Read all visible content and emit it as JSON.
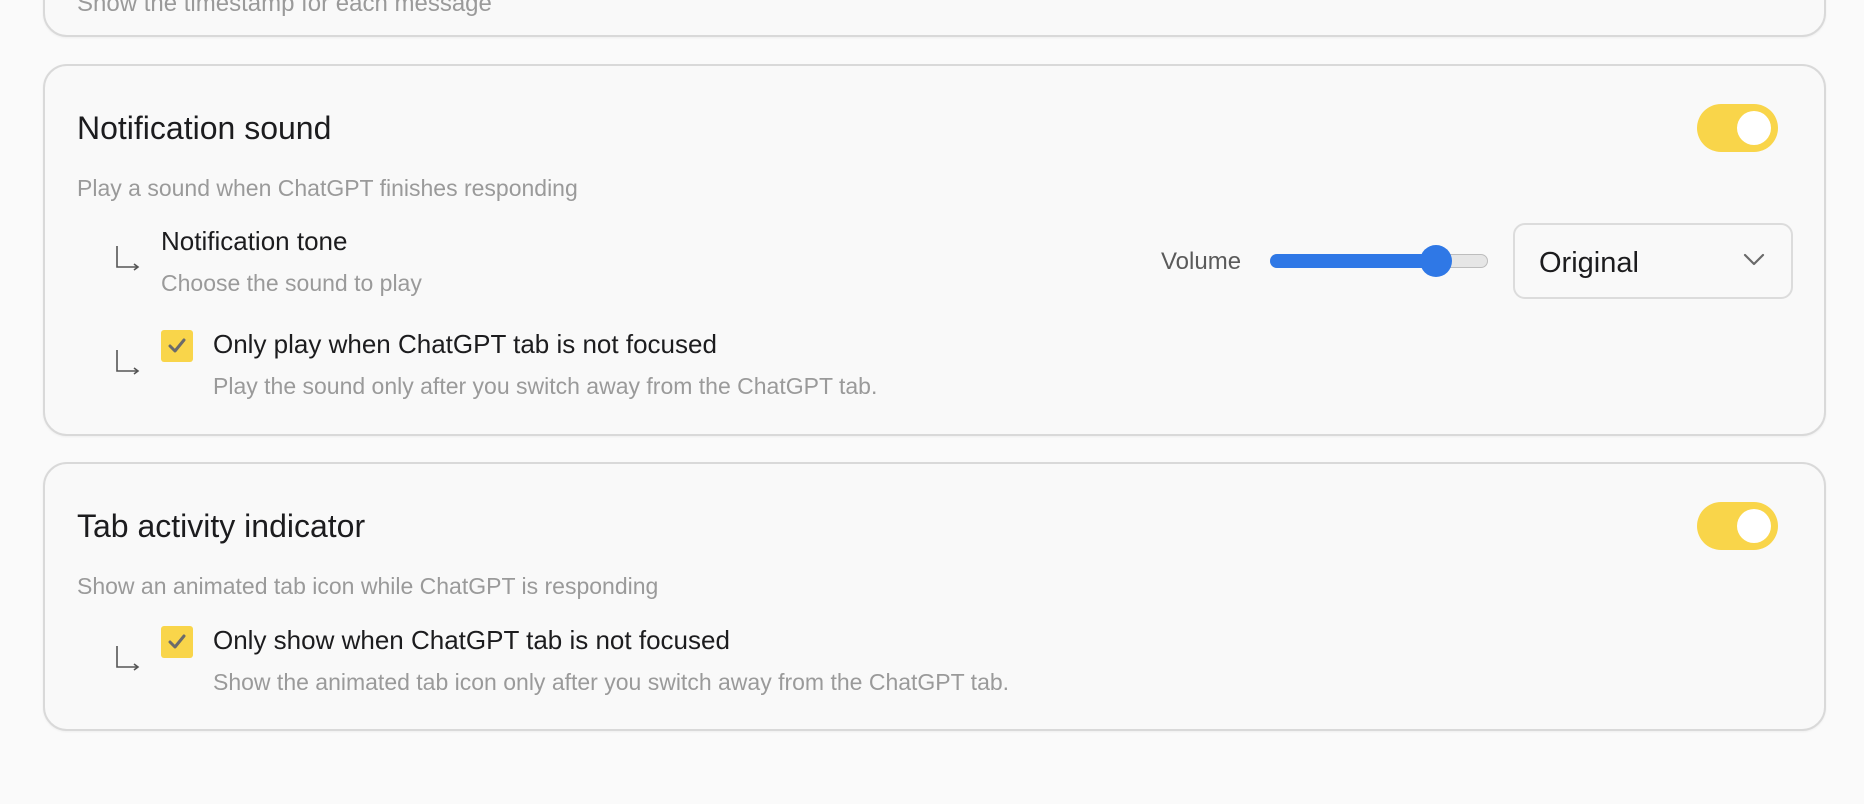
{
  "top_card": {
    "desc": "Show the timestamp for each message"
  },
  "notification_sound": {
    "title": "Notification sound",
    "desc": "Play a sound when ChatGPT finishes responding",
    "enabled": true,
    "tone": {
      "title": "Notification tone",
      "desc": "Choose the sound to play",
      "volume_label": "Volume",
      "volume": 0.76,
      "selected": "Original"
    },
    "only_unfocused": {
      "checked": true,
      "title": "Only play when ChatGPT tab is not focused",
      "desc": "Play the sound only after you switch away from the ChatGPT tab."
    }
  },
  "tab_activity": {
    "title": "Tab activity indicator",
    "desc": "Show an animated tab icon while ChatGPT is responding",
    "enabled": true,
    "only_unfocused": {
      "checked": true,
      "title": "Only show when ChatGPT tab is not focused",
      "desc": "Show the animated tab icon only after you switch away from the ChatGPT tab."
    }
  },
  "colors": {
    "accent_yellow": "#f9d54a",
    "slider_blue": "#2f78e6",
    "muted_text": "#9a9a9a"
  }
}
